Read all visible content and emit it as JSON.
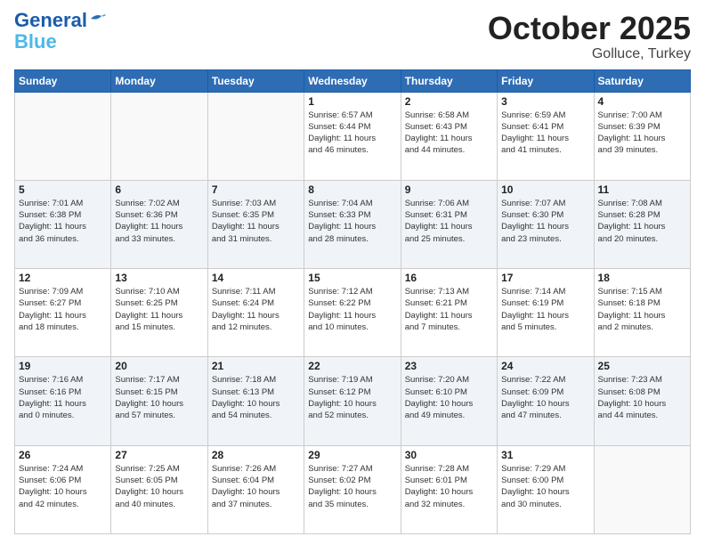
{
  "header": {
    "logo_line1": "General",
    "logo_line2": "Blue",
    "month": "October 2025",
    "location": "Golluce, Turkey"
  },
  "days_of_week": [
    "Sunday",
    "Monday",
    "Tuesday",
    "Wednesday",
    "Thursday",
    "Friday",
    "Saturday"
  ],
  "weeks": [
    [
      {
        "day": "",
        "info": ""
      },
      {
        "day": "",
        "info": ""
      },
      {
        "day": "",
        "info": ""
      },
      {
        "day": "1",
        "info": "Sunrise: 6:57 AM\nSunset: 6:44 PM\nDaylight: 11 hours\nand 46 minutes."
      },
      {
        "day": "2",
        "info": "Sunrise: 6:58 AM\nSunset: 6:43 PM\nDaylight: 11 hours\nand 44 minutes."
      },
      {
        "day": "3",
        "info": "Sunrise: 6:59 AM\nSunset: 6:41 PM\nDaylight: 11 hours\nand 41 minutes."
      },
      {
        "day": "4",
        "info": "Sunrise: 7:00 AM\nSunset: 6:39 PM\nDaylight: 11 hours\nand 39 minutes."
      }
    ],
    [
      {
        "day": "5",
        "info": "Sunrise: 7:01 AM\nSunset: 6:38 PM\nDaylight: 11 hours\nand 36 minutes."
      },
      {
        "day": "6",
        "info": "Sunrise: 7:02 AM\nSunset: 6:36 PM\nDaylight: 11 hours\nand 33 minutes."
      },
      {
        "day": "7",
        "info": "Sunrise: 7:03 AM\nSunset: 6:35 PM\nDaylight: 11 hours\nand 31 minutes."
      },
      {
        "day": "8",
        "info": "Sunrise: 7:04 AM\nSunset: 6:33 PM\nDaylight: 11 hours\nand 28 minutes."
      },
      {
        "day": "9",
        "info": "Sunrise: 7:06 AM\nSunset: 6:31 PM\nDaylight: 11 hours\nand 25 minutes."
      },
      {
        "day": "10",
        "info": "Sunrise: 7:07 AM\nSunset: 6:30 PM\nDaylight: 11 hours\nand 23 minutes."
      },
      {
        "day": "11",
        "info": "Sunrise: 7:08 AM\nSunset: 6:28 PM\nDaylight: 11 hours\nand 20 minutes."
      }
    ],
    [
      {
        "day": "12",
        "info": "Sunrise: 7:09 AM\nSunset: 6:27 PM\nDaylight: 11 hours\nand 18 minutes."
      },
      {
        "day": "13",
        "info": "Sunrise: 7:10 AM\nSunset: 6:25 PM\nDaylight: 11 hours\nand 15 minutes."
      },
      {
        "day": "14",
        "info": "Sunrise: 7:11 AM\nSunset: 6:24 PM\nDaylight: 11 hours\nand 12 minutes."
      },
      {
        "day": "15",
        "info": "Sunrise: 7:12 AM\nSunset: 6:22 PM\nDaylight: 11 hours\nand 10 minutes."
      },
      {
        "day": "16",
        "info": "Sunrise: 7:13 AM\nSunset: 6:21 PM\nDaylight: 11 hours\nand 7 minutes."
      },
      {
        "day": "17",
        "info": "Sunrise: 7:14 AM\nSunset: 6:19 PM\nDaylight: 11 hours\nand 5 minutes."
      },
      {
        "day": "18",
        "info": "Sunrise: 7:15 AM\nSunset: 6:18 PM\nDaylight: 11 hours\nand 2 minutes."
      }
    ],
    [
      {
        "day": "19",
        "info": "Sunrise: 7:16 AM\nSunset: 6:16 PM\nDaylight: 11 hours\nand 0 minutes."
      },
      {
        "day": "20",
        "info": "Sunrise: 7:17 AM\nSunset: 6:15 PM\nDaylight: 10 hours\nand 57 minutes."
      },
      {
        "day": "21",
        "info": "Sunrise: 7:18 AM\nSunset: 6:13 PM\nDaylight: 10 hours\nand 54 minutes."
      },
      {
        "day": "22",
        "info": "Sunrise: 7:19 AM\nSunset: 6:12 PM\nDaylight: 10 hours\nand 52 minutes."
      },
      {
        "day": "23",
        "info": "Sunrise: 7:20 AM\nSunset: 6:10 PM\nDaylight: 10 hours\nand 49 minutes."
      },
      {
        "day": "24",
        "info": "Sunrise: 7:22 AM\nSunset: 6:09 PM\nDaylight: 10 hours\nand 47 minutes."
      },
      {
        "day": "25",
        "info": "Sunrise: 7:23 AM\nSunset: 6:08 PM\nDaylight: 10 hours\nand 44 minutes."
      }
    ],
    [
      {
        "day": "26",
        "info": "Sunrise: 7:24 AM\nSunset: 6:06 PM\nDaylight: 10 hours\nand 42 minutes."
      },
      {
        "day": "27",
        "info": "Sunrise: 7:25 AM\nSunset: 6:05 PM\nDaylight: 10 hours\nand 40 minutes."
      },
      {
        "day": "28",
        "info": "Sunrise: 7:26 AM\nSunset: 6:04 PM\nDaylight: 10 hours\nand 37 minutes."
      },
      {
        "day": "29",
        "info": "Sunrise: 7:27 AM\nSunset: 6:02 PM\nDaylight: 10 hours\nand 35 minutes."
      },
      {
        "day": "30",
        "info": "Sunrise: 7:28 AM\nSunset: 6:01 PM\nDaylight: 10 hours\nand 32 minutes."
      },
      {
        "day": "31",
        "info": "Sunrise: 7:29 AM\nSunset: 6:00 PM\nDaylight: 10 hours\nand 30 minutes."
      },
      {
        "day": "",
        "info": ""
      }
    ]
  ]
}
